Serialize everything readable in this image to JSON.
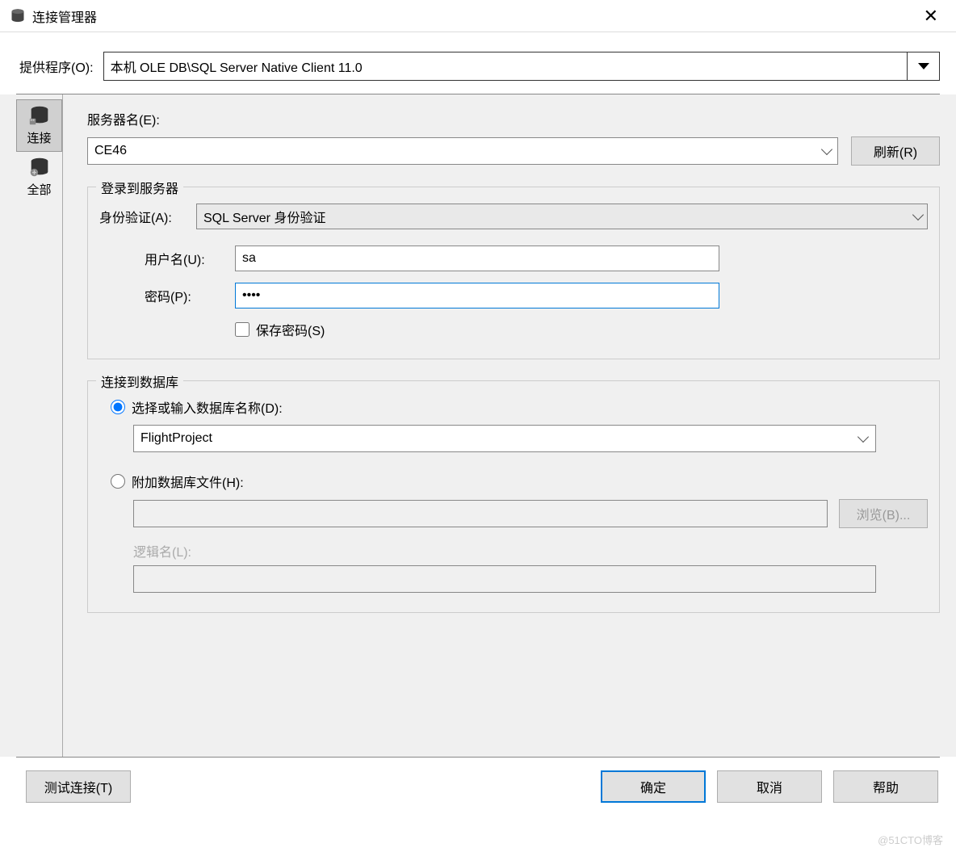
{
  "window": {
    "title": "连接管理器"
  },
  "provider": {
    "label": "提供程序(O):",
    "value": "本机 OLE DB\\SQL Server Native Client 11.0"
  },
  "sidetabs": {
    "connect": "连接",
    "all": "全部"
  },
  "server": {
    "label": "服务器名(E):",
    "value": "CE46",
    "refresh": "刷新(R)"
  },
  "login_group": "登录到服务器",
  "auth": {
    "label": "身份验证(A):",
    "value": "SQL Server 身份验证"
  },
  "username": {
    "label": "用户名(U):",
    "value": "sa"
  },
  "password": {
    "label": "密码(P):",
    "value": "••••"
  },
  "save_password": "保存密码(S)",
  "db_group": "连接到数据库",
  "db_select_radio": "选择或输入数据库名称(D):",
  "db_name": "FlightProject",
  "db_attach_radio": "附加数据库文件(H):",
  "browse": "浏览(B)...",
  "logical_name": "逻辑名(L):",
  "buttons": {
    "test": "测试连接(T)",
    "ok": "确定",
    "cancel": "取消",
    "help": "帮助"
  },
  "watermark": "@51CTO博客"
}
